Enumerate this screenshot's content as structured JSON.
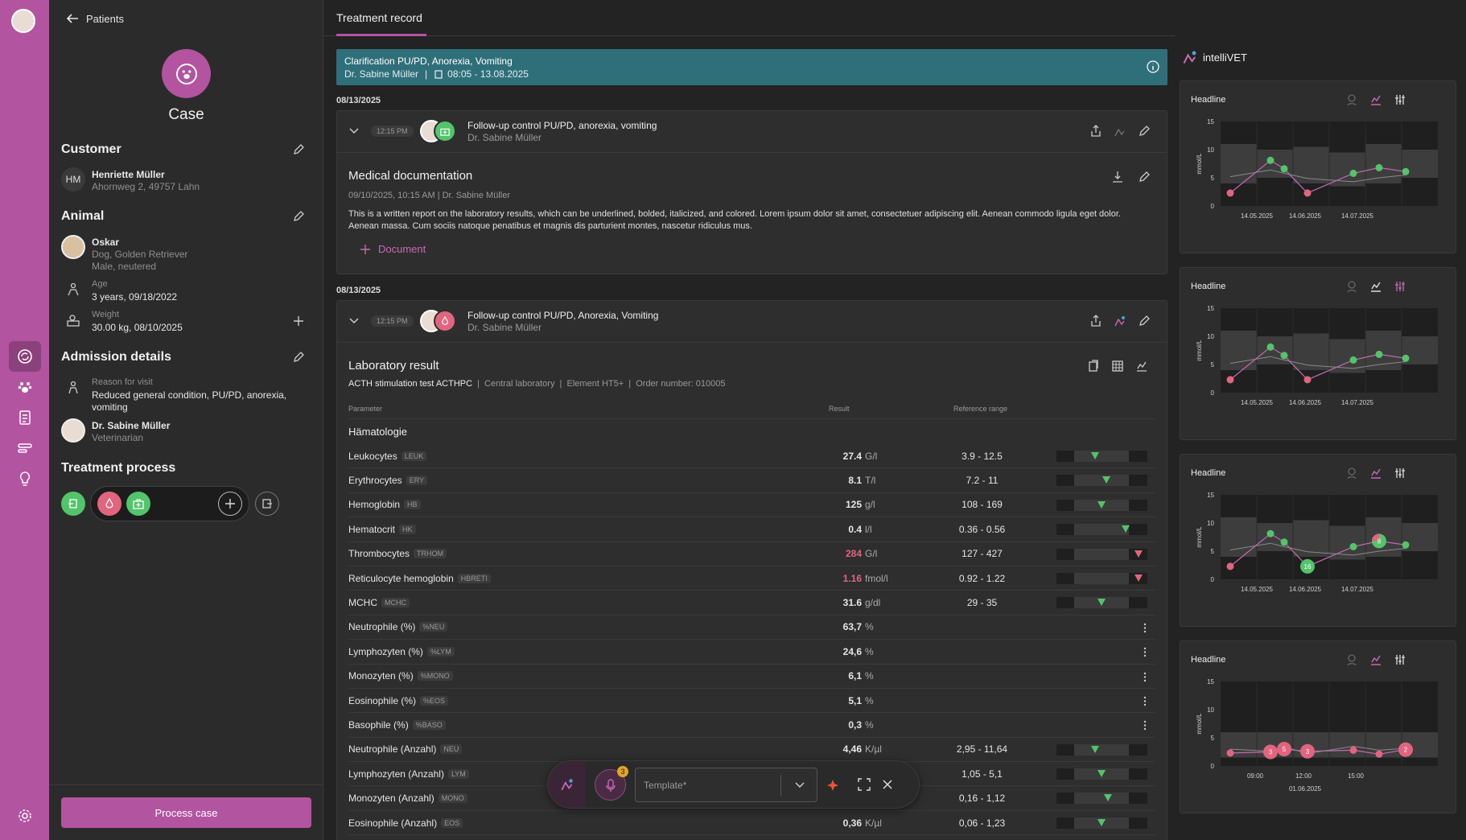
{
  "sidebar": {
    "items": [
      "avatar",
      "case",
      "animal",
      "record",
      "list",
      "insight"
    ],
    "settings": "settings"
  },
  "patient_panel": {
    "back_label": "Patients",
    "case_title": "Case",
    "customer": {
      "title": "Customer",
      "initials": "HM",
      "name": "Henriette Müller",
      "address": "Ahornweg 2, 49757 Lahn"
    },
    "animal": {
      "title": "Animal",
      "name": "Oskar",
      "breed": "Dog, Golden Retriever",
      "sex": "Male, neutered",
      "age_label": "Age",
      "age_value": "3 years, 09/18/2022",
      "weight_label": "Weight",
      "weight_value": "30.00 kg, 08/10/2025"
    },
    "admission": {
      "title": "Admission details",
      "reason_label": "Reason for visit",
      "reason_value": "Reduced general condition, PU/PD, anorexia, vomiting",
      "vet_name": "Dr. Sabine Müller",
      "vet_role": "Veterinarian"
    },
    "process": {
      "title": "Treatment process"
    },
    "process_button": "Process case"
  },
  "main": {
    "tab": "Treatment record",
    "banner": {
      "title": "Clarification PU/PD, Anorexia, Vomiting",
      "doctor": "Dr. Sabine Müller",
      "sep": "|",
      "time": "08:05 - 13.08.2025"
    },
    "entries": [
      {
        "date": "08/13/2025",
        "time": "12:15 PM",
        "title": "Follow-up control PU/PD, anorexia, vomiting",
        "doctor": "Dr. Sabine Müller"
      },
      {
        "date": "08/13/2025",
        "time": "12:15 PM",
        "title": "Follow-up control PU/PD, Anorexia, Vomiting",
        "doctor": "Dr. Sabine Müller"
      }
    ],
    "doc": {
      "title": "Medical documentation",
      "meta": "09/10/2025, 10:15 AM  |  Dr. Sabine Müller",
      "body": "This is a written report on the laboratory results, which can be underlined, bolded, italicized, and colored. Lorem ipsum dolor sit amet, consectetuer adipiscing elit. Aenean commodo ligula eget dolor. Aenean massa. Cum sociis natoque penatibus et magnis dis parturient montes, nascetur ridiculus mus.",
      "add_label": "Document"
    },
    "lab": {
      "title": "Laboratory result",
      "test": "ACTH stimulation test ACTHPC",
      "meta": "|  Central laboratory  |  Element HT5+  |  Order number: 010005",
      "col_param": "Parameter",
      "col_result": "Result",
      "col_ref": "Reference range",
      "group": "Hämatologie",
      "rows": [
        {
          "name": "Leukocytes",
          "tag": "LEUK",
          "value": "27.4",
          "unit": "G/l",
          "ref": "3.9 - 12.5",
          "high": false,
          "level": 0.32,
          "bar": true
        },
        {
          "name": "Erythrocytes",
          "tag": "ERY",
          "value": "8.1",
          "unit": "T/l",
          "ref": "7.2 - 11",
          "high": false,
          "level": 0.5,
          "bar": true
        },
        {
          "name": "Hemoglobin",
          "tag": "HB",
          "value": "125",
          "unit": "g/l",
          "ref": "108 - 169",
          "high": false,
          "level": 0.42,
          "bar": true
        },
        {
          "name": "Hematocrit",
          "tag": "HK",
          "value": "0.4",
          "unit": "l/l",
          "ref": "0.36 - 0.56",
          "high": false,
          "level": 0.8,
          "bar": true
        },
        {
          "name": "Thrombocytes",
          "tag": "TRHOM",
          "value": "284",
          "unit": "G/l",
          "ref": "127 - 427",
          "high": true,
          "level": 1.0,
          "bar": true
        },
        {
          "name": "Reticulocyte hemoglobin",
          "tag": "HBRETI",
          "value": "1.16",
          "unit": "fmol/l",
          "ref": "0.92 - 1.22",
          "high": true,
          "level": 1.0,
          "bar": true
        },
        {
          "name": "MCHC",
          "tag": "MCHC",
          "value": "31.6",
          "unit": "g/dl",
          "ref": "29 - 35",
          "high": false,
          "level": 0.42,
          "bar": true
        },
        {
          "name": "Neutrophile (%)",
          "tag": "%NEU",
          "value": "63,7",
          "unit": "%",
          "ref": "",
          "high": false,
          "level": 0,
          "bar": false
        },
        {
          "name": "Lymphozyten (%)",
          "tag": "%LYM",
          "value": "24,6",
          "unit": "%",
          "ref": "",
          "high": false,
          "level": 0,
          "bar": false
        },
        {
          "name": "Monozyten (%)",
          "tag": "%MONO",
          "value": "6,1",
          "unit": "%",
          "ref": "",
          "high": false,
          "level": 0,
          "bar": false
        },
        {
          "name": "Eosinophile (%)",
          "tag": "%EOS",
          "value": "5,1",
          "unit": "%",
          "ref": "",
          "high": false,
          "level": 0,
          "bar": false
        },
        {
          "name": "Basophile (%)",
          "tag": "%BASO",
          "value": "0,3",
          "unit": "%",
          "ref": "",
          "high": false,
          "level": 0,
          "bar": false
        },
        {
          "name": "Neutrophile (Anzahl)",
          "tag": "NEU",
          "value": "4,46",
          "unit": "K/µl",
          "ref": "2,95 - 11,64",
          "high": false,
          "level": 0.32,
          "bar": true
        },
        {
          "name": "Lymphozyten (Anzahl)",
          "tag": "LYM",
          "value": "",
          "unit": "",
          "ref": "1,05 - 5,1",
          "high": false,
          "level": 0.42,
          "bar": true
        },
        {
          "name": "Monozyten (Anzahl)",
          "tag": "MONO",
          "value": "",
          "unit": "",
          "ref": "0,16 - 1,12",
          "high": false,
          "level": 0.52,
          "bar": true
        },
        {
          "name": "Eosinophile (Anzahl)",
          "tag": "EOS",
          "value": "0,36",
          "unit": "K/µl",
          "ref": "0,06 - 1,23",
          "high": false,
          "level": 0.42,
          "bar": true
        }
      ]
    },
    "toolbar": {
      "template_placeholder": "Template*",
      "mic_badge": "3"
    }
  },
  "right_panel": {
    "brand": "intelliVET"
  },
  "colors": {
    "accent": "#b2549f",
    "green": "#52c46a",
    "red": "#e2647f",
    "banner": "#2f6f7a"
  },
  "chart_data": [
    {
      "type": "line",
      "title": "Headline",
      "ylabel": "mmol/L",
      "ylim": [
        0,
        15
      ],
      "yticks": [
        0,
        5,
        10,
        15
      ],
      "xticks": [
        "14.05.2025",
        "14.06.2025",
        "14.07.2025"
      ],
      "x": [
        0,
        1,
        2,
        3,
        4,
        5,
        6,
        7
      ],
      "series": [
        {
          "values": [
            2.3,
            8.1,
            6.6,
            2.3,
            5.8,
            6.8,
            6.1
          ]
        },
        {
          "values": [
            5.2,
            6.4,
            5.8,
            4.9,
            4.3,
            5.0,
            5.5
          ]
        }
      ],
      "points": [
        {
          "i": 0,
          "v": 2.3,
          "c": "red"
        },
        {
          "i": 1,
          "v": 8.1,
          "c": "green"
        },
        {
          "i": 2,
          "v": 6.6,
          "c": "green"
        },
        {
          "i": 3,
          "v": 2.3,
          "c": "red"
        },
        {
          "i": 4,
          "v": 5.8,
          "c": "green"
        },
        {
          "i": 5,
          "v": 6.8,
          "c": "green"
        },
        {
          "i": 6,
          "v": 6.1,
          "c": "green"
        }
      ]
    },
    {
      "type": "line",
      "title": "Headline",
      "ylabel": "mmol/L",
      "ylim": [
        0,
        15
      ],
      "yticks": [
        0,
        5,
        10,
        15
      ],
      "xticks": [
        "14.05.2025",
        "14.06.2025",
        "14.07.2025"
      ],
      "series": [
        {
          "values": [
            2.3,
            8.1,
            6.6,
            2.3,
            5.8,
            6.8,
            6.1
          ]
        },
        {
          "values": [
            5.2,
            6.4,
            5.8,
            4.9,
            4.3,
            5.0,
            5.5
          ]
        }
      ],
      "points": [
        {
          "i": 0,
          "v": 2.3,
          "c": "red"
        },
        {
          "i": 1,
          "v": 8.1,
          "c": "green"
        },
        {
          "i": 2,
          "v": 6.6,
          "c": "green"
        },
        {
          "i": 3,
          "v": 2.3,
          "c": "red"
        },
        {
          "i": 4,
          "v": 5.8,
          "c": "green"
        },
        {
          "i": 5,
          "v": 6.8,
          "c": "green"
        },
        {
          "i": 6,
          "v": 6.1,
          "c": "green"
        }
      ]
    },
    {
      "type": "line",
      "title": "Headline",
      "ylabel": "mmol/L",
      "ylim": [
        0,
        15
      ],
      "yticks": [
        0,
        5,
        10,
        15
      ],
      "xticks": [
        "14.05.2025",
        "14.06.2025",
        "14.07.2025"
      ],
      "series": [
        {
          "values": [
            2.3,
            8.1,
            6.6,
            2.3,
            5.8,
            6.8,
            6.1
          ]
        },
        {
          "values": [
            5.2,
            6.4,
            5.8,
            4.9,
            4.3,
            5.0,
            5.5
          ]
        }
      ],
      "points": [
        {
          "i": 0,
          "v": 2.3,
          "c": "red"
        },
        {
          "i": 1,
          "v": 8.1,
          "c": "green"
        },
        {
          "i": 2,
          "v": 6.6,
          "c": "green"
        },
        {
          "i": 3,
          "v": 2.3,
          "c": "green",
          "big": "16"
        },
        {
          "i": 4,
          "v": 5.8,
          "c": "green"
        },
        {
          "i": 5,
          "v": 6.8,
          "c": "mixed",
          "big": "8"
        },
        {
          "i": 6,
          "v": 6.1,
          "c": "green"
        }
      ]
    },
    {
      "type": "line",
      "title": "Headline",
      "ylabel": "mmol/L",
      "ylim": [
        0,
        15
      ],
      "yticks": [
        0,
        5,
        10,
        15
      ],
      "xticks": [
        "09:00",
        "12:00",
        "15:00"
      ],
      "xlabel2": "01.06.2025",
      "series": [
        {
          "values": [
            2.3,
            2.5,
            3.0,
            2.6,
            2.8,
            2.1,
            2.9
          ]
        },
        {
          "values": [
            3.0,
            2.6,
            3.4,
            2.2,
            3.5,
            2.8,
            3.1
          ]
        }
      ],
      "points": [
        {
          "i": 0,
          "v": 2.3,
          "c": "red"
        },
        {
          "i": 1,
          "v": 2.5,
          "c": "red",
          "big": "3"
        },
        {
          "i": 2,
          "v": 3.0,
          "c": "red",
          "big": "5"
        },
        {
          "i": 3,
          "v": 2.6,
          "c": "red",
          "big": "3"
        },
        {
          "i": 4,
          "v": 2.8,
          "c": "red"
        },
        {
          "i": 5,
          "v": 2.1,
          "c": "red"
        },
        {
          "i": 6,
          "v": 2.9,
          "c": "red",
          "big": "2"
        }
      ]
    }
  ]
}
